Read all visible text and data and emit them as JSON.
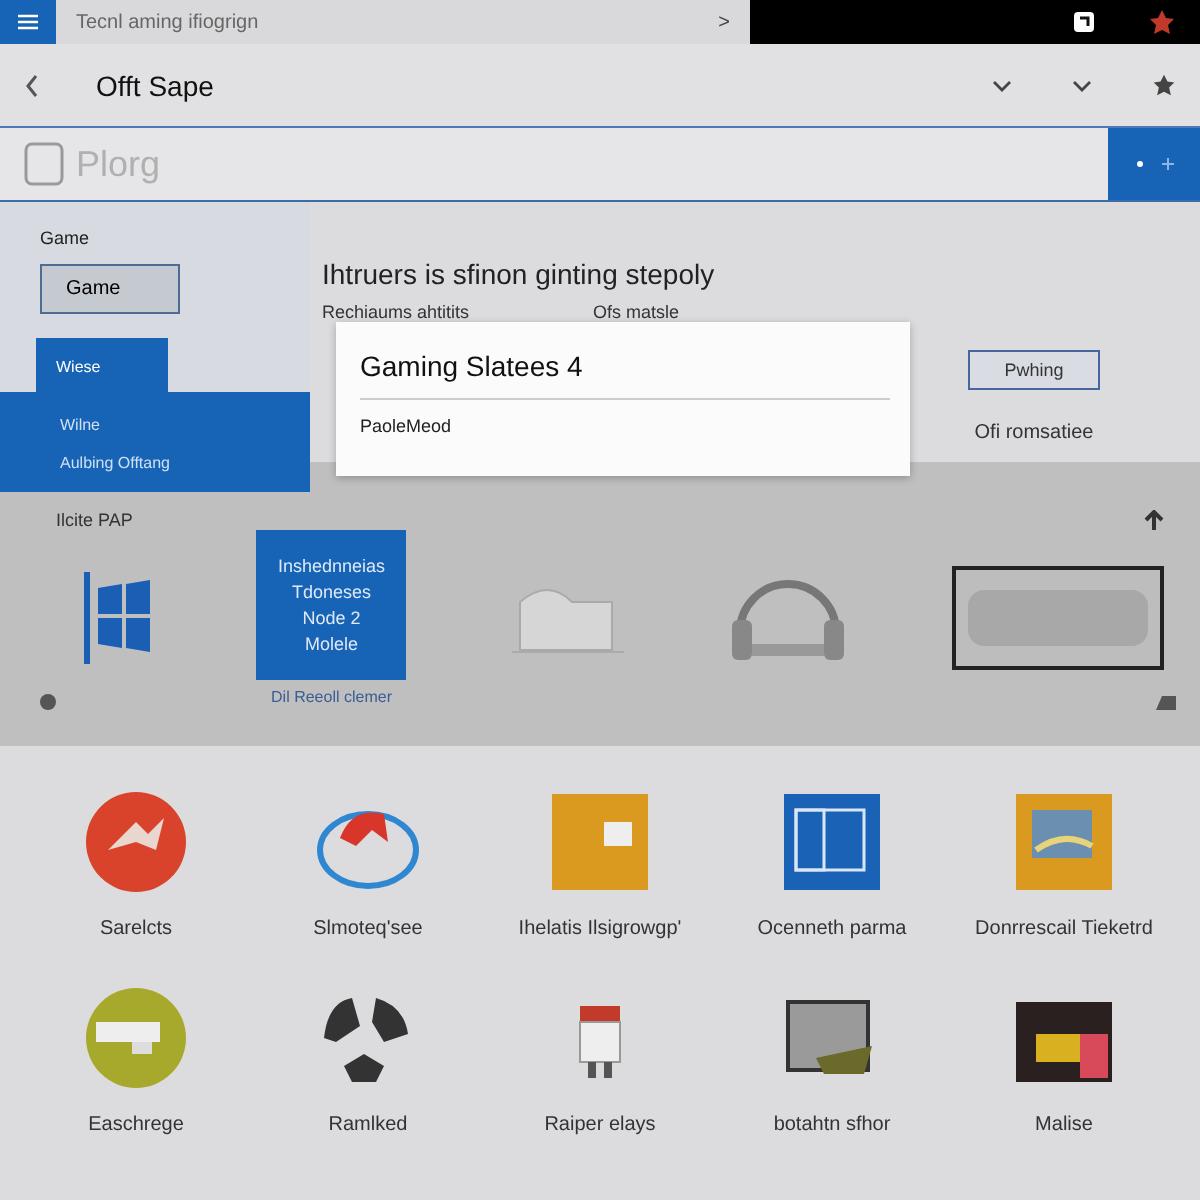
{
  "top_bar": {
    "tab_title": "Tecnl aming ifiogrign",
    "tab_arrow": ">"
  },
  "header": {
    "title": "Offt Sape"
  },
  "search": {
    "placeholder": "Plorg"
  },
  "sidebar": {
    "label": "Game",
    "items": [
      {
        "label": "Game",
        "selected": true
      }
    ]
  },
  "dropdown": {
    "items": [
      {
        "label": "Wiese",
        "selected": true
      },
      {
        "label": "Wilne",
        "selected": false
      },
      {
        "label": "Aulbing Offtang",
        "selected": false
      }
    ]
  },
  "content": {
    "heading": "Ihtruers is sfinon ginting stepoly",
    "left_label": "Rechiaums ahtitits",
    "right_label": "Ofs matsle",
    "button": "Pwhing",
    "note": "Ofi romsatiee"
  },
  "dialog": {
    "title": "Gaming Slatees 4",
    "body": "PaoleMeod"
  },
  "featured": {
    "label": "Ilcite PAP",
    "tile_lines": [
      "Inshednneias",
      "Tdoneses",
      "Node 2",
      "Molele"
    ],
    "tile_caption": "Dil Reeoll clemer"
  },
  "apps": [
    {
      "name": "Sarelcts"
    },
    {
      "name": "Slmoteq'see"
    },
    {
      "name": "Ihelatis Ilsigrowgp'"
    },
    {
      "name": "Ocenneth parma"
    },
    {
      "name": "Donrrescail Tieketrd"
    },
    {
      "name": "Easchrege"
    },
    {
      "name": "Ramlked"
    },
    {
      "name": "Raiper elays"
    },
    {
      "name": "botahtn sfhor"
    },
    {
      "name": "Malise"
    }
  ]
}
